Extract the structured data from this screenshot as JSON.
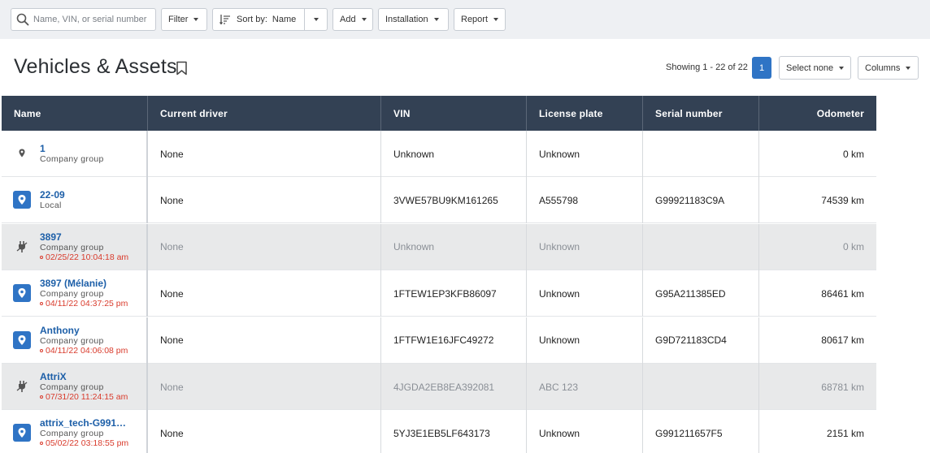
{
  "toolbar": {
    "search_placeholder": "Name, VIN, or serial number",
    "filter_label": "Filter",
    "sort_prefix": "Sort by:",
    "sort_value": "Name",
    "add_label": "Add",
    "installation_label": "Installation",
    "report_label": "Report"
  },
  "header": {
    "title": "Vehicles & Assets",
    "showing": "Showing 1 - 22 of 22",
    "current_page": "1",
    "select_none_label": "Select none",
    "columns_label": "Columns"
  },
  "table": {
    "columns": [
      "Name",
      "Current driver",
      "VIN",
      "License plate",
      "Serial number",
      "Odometer"
    ],
    "rows": [
      {
        "name": "1",
        "group": "Company group",
        "time": "",
        "icon": "location-pin-icon",
        "inactive": false,
        "driver": "None",
        "vin": "Unknown",
        "plate": "Unknown",
        "serial": "",
        "odometer": "0 km"
      },
      {
        "name": "22-09",
        "group": "Local",
        "time": "",
        "icon": "location-pin-icon",
        "inactive": false,
        "driver": "None",
        "vin": "3VWE57BU9KM161265",
        "plate": "A555798",
        "serial": "G99921183C9A",
        "odometer": "74539 km"
      },
      {
        "name": "3897",
        "group": "Company group",
        "time": "02/25/22 10:04:18 am",
        "icon": "unplugged-icon",
        "inactive": true,
        "driver": "None",
        "vin": "Unknown",
        "plate": "Unknown",
        "serial": "",
        "odometer": "0 km"
      },
      {
        "name": "3897 (Mélanie)",
        "group": "Company group",
        "time": "04/11/22 04:37:25 pm",
        "icon": "location-pin-icon",
        "inactive": false,
        "driver": "None",
        "vin": "1FTEW1EP3KFB86097",
        "plate": "Unknown",
        "serial": "G95A211385ED",
        "odometer": "86461 km"
      },
      {
        "name": "Anthony",
        "group": "Company group",
        "time": "04/11/22 04:06:08 pm",
        "icon": "location-pin-icon",
        "inactive": false,
        "driver": "None",
        "vin": "1FTFW1E16JFC49272",
        "plate": "Unknown",
        "serial": "G9D721183CD4",
        "odometer": "80617 km"
      },
      {
        "name": "AttriX",
        "group": "Company group",
        "time": "07/31/20 11:24:15 am",
        "icon": "unplugged-icon",
        "inactive": true,
        "driver": "None",
        "vin": "4JGDA2EB8EA392081",
        "plate": "ABC 123",
        "serial": "",
        "odometer": "68781 km"
      },
      {
        "name": "attrix_tech-G991…",
        "group": "Company group",
        "time": "05/02/22 03:18:55 pm",
        "icon": "location-pin-icon",
        "inactive": false,
        "driver": "None",
        "vin": "5YJ3E1EB5LF643173",
        "plate": "Unknown",
        "serial": "G991211657F5",
        "odometer": "2151 km"
      }
    ]
  },
  "colors": {
    "header_bg": "#334154",
    "accent_blue": "#2f74c5",
    "link_blue": "#1d5fa8",
    "time_red": "#d93b2c",
    "inactive_row": "#e8e9ea"
  }
}
